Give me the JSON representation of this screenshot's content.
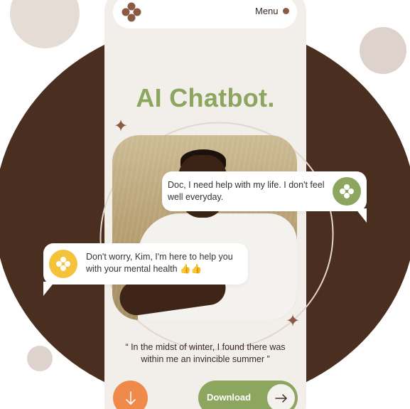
{
  "header": {
    "menu_label": "Menu",
    "logo_icon": "four-dot-flower-icon"
  },
  "hero": {
    "title": "AI Chatbot."
  },
  "chat": {
    "user_message": "Doc, I need help with my life. I don't feel well everyday.",
    "bot_message": "Don't worry, Kim, I'm here to help you with your mental health 👍👍"
  },
  "quote": {
    "text": "“ In the midst of winter, I found there was within me an invincible summer ”"
  },
  "actions": {
    "download_label": "Download",
    "scroll_icon": "arrow-down-icon",
    "download_icon": "arrow-right-icon"
  },
  "colors": {
    "brand_brown": "#4a2f20",
    "accent_green": "#8ca660",
    "accent_orange": "#f08a4b",
    "accent_yellow": "#f5c33b"
  }
}
